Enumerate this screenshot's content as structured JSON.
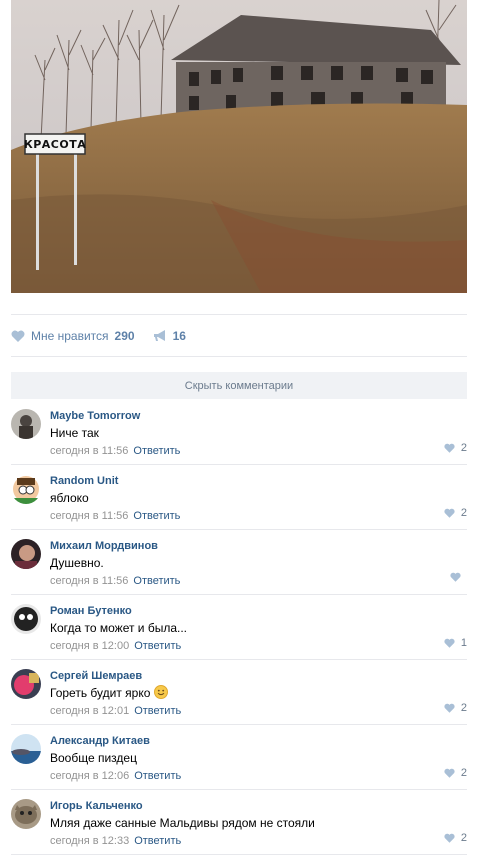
{
  "post": {
    "photo_sign": "КРАСОТА",
    "likes_label": "Мне нравится",
    "likes_count": "290",
    "reposts_count": "16"
  },
  "hide_comments_label": "Скрыть комментарии",
  "reply_label": "Ответить",
  "comments": [
    {
      "author": "Maybe Tomorrow",
      "text": "Ниче так",
      "time": "сегодня в 11:56",
      "likes": "2"
    },
    {
      "author": "Random Unit",
      "text": "яблоко",
      "time": "сегодня в 11:56",
      "likes": "2"
    },
    {
      "author": "Михаил Мордвинов",
      "text": "Душевно.",
      "time": "сегодня в 11:56",
      "likes": ""
    },
    {
      "author": "Роман Бутенко",
      "text": "Когда то может и была...",
      "time": "сегодня в 12:00",
      "likes": "1"
    },
    {
      "author": "Сергей Шемраев",
      "text": "Гореть будит ярко",
      "time": "сегодня в 12:01",
      "likes": "2"
    },
    {
      "author": "Александр Китаев",
      "text": "Вообще пиздец",
      "time": "сегодня в 12:06",
      "likes": "2"
    },
    {
      "author": "Игорь Кальченко",
      "text": "Мляя даже санные Мальдивы рядом не стояли",
      "time": "сегодня в 12:33",
      "likes": "2"
    }
  ]
}
